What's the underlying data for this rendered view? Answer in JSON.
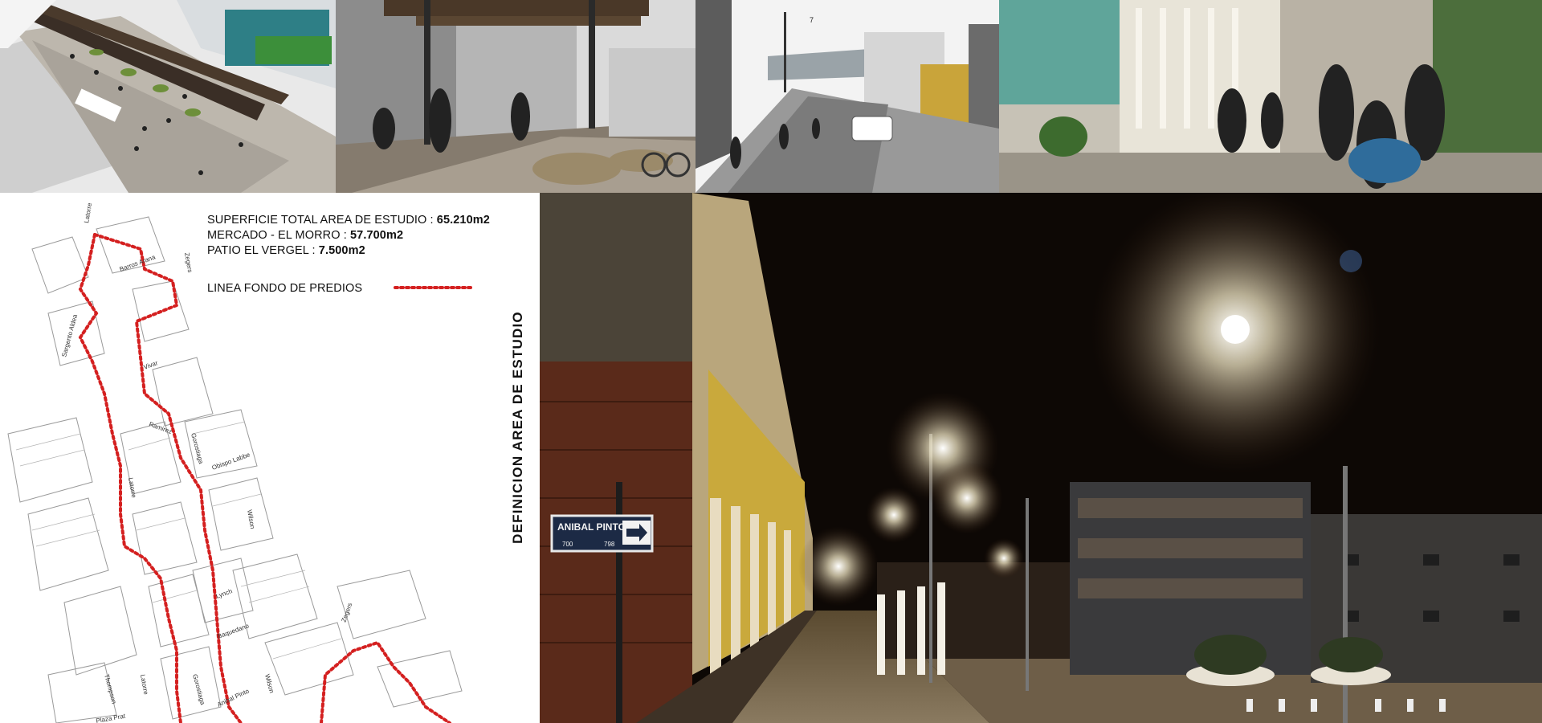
{
  "study_area": {
    "title": "DEFINICION  AREA DE ESTUDIO",
    "lines": [
      {
        "label": "SUPERFICIE TOTAL AREA DE ESTUDIO : ",
        "value": "65.210m2"
      },
      {
        "label": "MERCADO - EL MORRO : ",
        "value": "57.700m2"
      },
      {
        "label": "PATIO EL VERGEL : ",
        "value": "7.500m2"
      }
    ],
    "legend_label": "LINEA FONDO DE PREDIOS",
    "legend_color": "#d42020"
  },
  "street_names": [
    "Latorre",
    "Barros Arana",
    "Zegers",
    "Sargento Aldea",
    "Vivar",
    "Ramirez",
    "Gorostiaga",
    "Latorre",
    "Obispo Labbe",
    "Wilson",
    "Lynch",
    "Baquedano",
    "Zegers",
    "Thompson",
    "Latorre",
    "Gorostiaga",
    "Anibal Pinto",
    "Wilson",
    "Plaza Prat"
  ],
  "photo_sign": {
    "name": "ANIBAL PINTO",
    "numbers": [
      "700",
      "798"
    ]
  },
  "render_label": "7",
  "colors": {
    "night_sky": "#0d0805",
    "lamp_glow": "#fff6d8",
    "sign_blue": "#1c2a45"
  }
}
